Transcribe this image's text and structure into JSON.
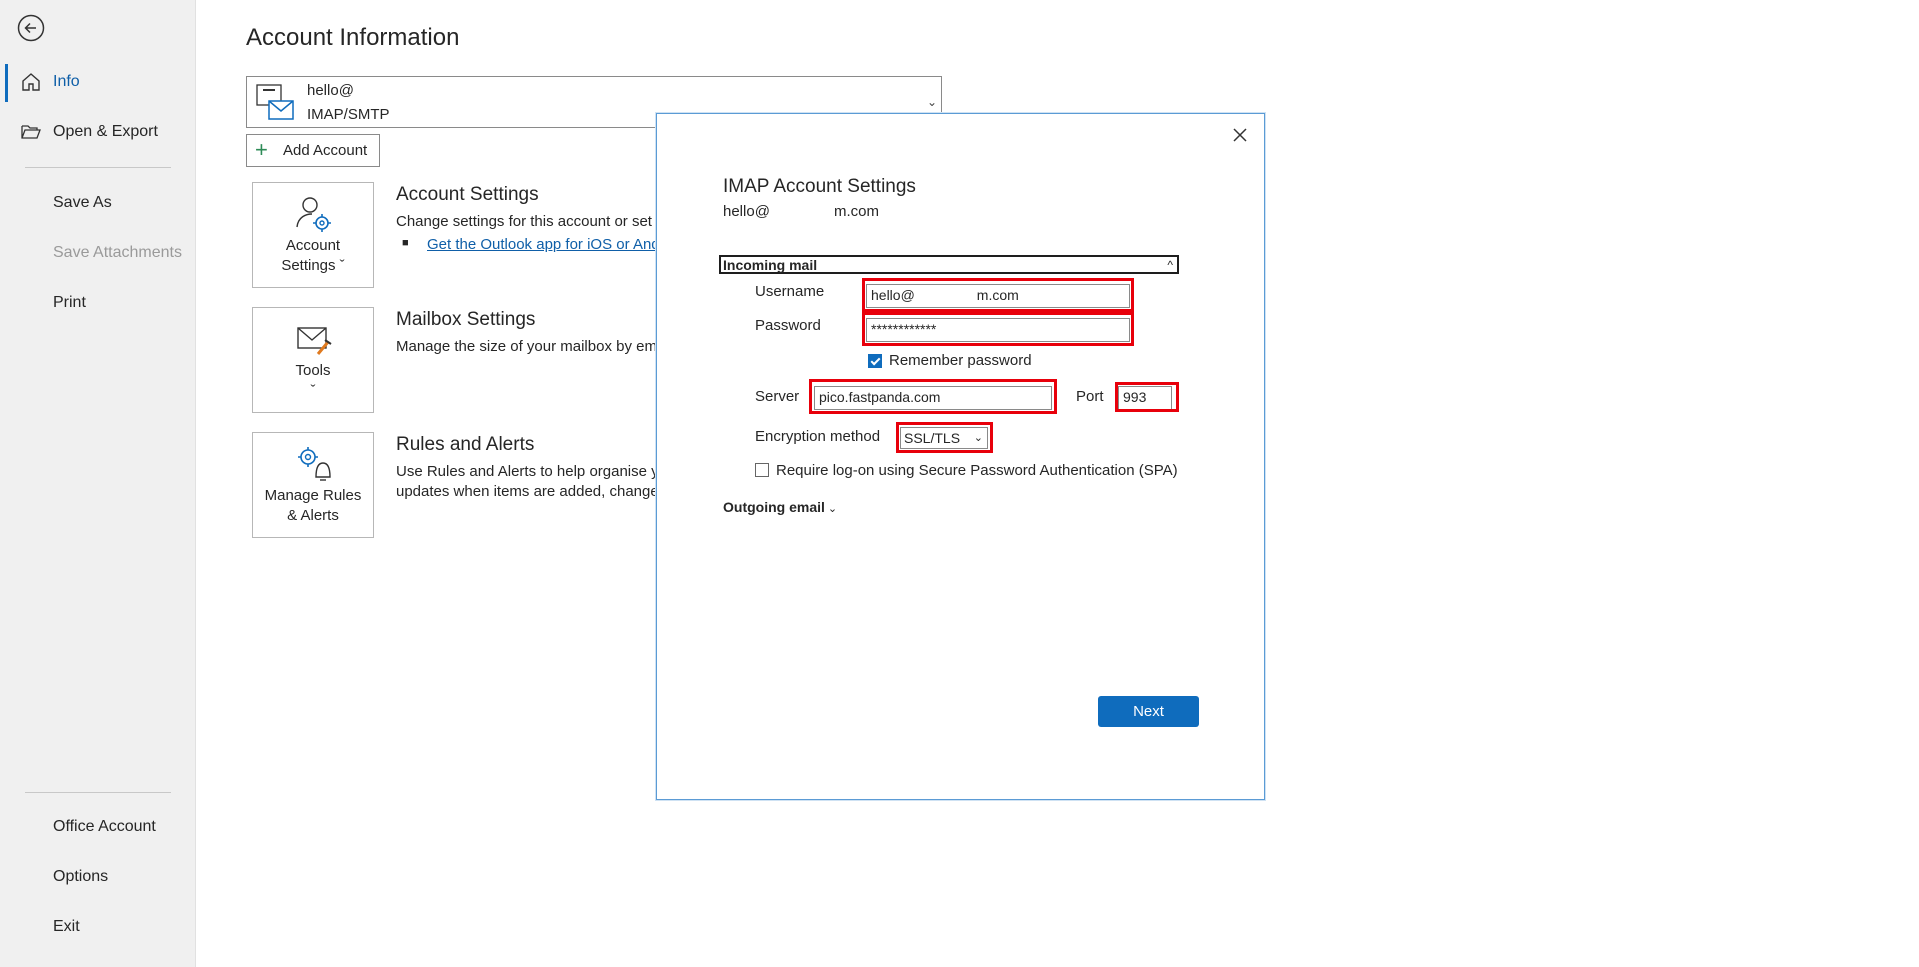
{
  "sidebar": {
    "back_icon": "back-arrow-icon",
    "items": [
      {
        "label": "Info",
        "icon": "home-icon",
        "active": true
      },
      {
        "label": "Open & Export",
        "icon": "folder-open-icon"
      },
      {
        "label": "Save As"
      },
      {
        "label": "Save Attachments",
        "disabled": true
      },
      {
        "label": "Print"
      },
      {
        "label": "Office Account"
      },
      {
        "label": "Options"
      },
      {
        "label": "Exit"
      }
    ]
  },
  "main": {
    "title": "Account Information",
    "account": {
      "email": "hello@",
      "type": "IMAP/SMTP"
    },
    "add_account_label": "Add Account",
    "tiles": [
      {
        "label_1": "Account",
        "label_2": "Settings ˇ",
        "icon": "account-settings-icon"
      },
      {
        "label_1": "Tools",
        "label_2": "ˇ",
        "icon": "tools-icon"
      },
      {
        "label_1": "Manage Rules",
        "label_2": "& Alerts",
        "icon": "rules-alerts-icon"
      }
    ],
    "sections": [
      {
        "title": "Account Settings",
        "text": "Change settings for this account or set u",
        "link": "Get the Outlook app for iOS or And"
      },
      {
        "title": "Mailbox Settings",
        "text": "Manage the size of your mailbox by em"
      },
      {
        "title": "Rules and Alerts",
        "text_1": "Use Rules and Alerts to help organise yo",
        "text_2": "updates when items are added, change"
      }
    ]
  },
  "dialog": {
    "title": "IMAP Account Settings",
    "email_prefix": "hello@",
    "email_suffix": "m.com",
    "incoming_header": "Incoming mail",
    "username_label": "Username",
    "username_value_prefix": "hello@",
    "username_value_suffix": "m.com",
    "password_label": "Password",
    "password_value": "************",
    "remember_password_label": "Remember password",
    "remember_password_checked": true,
    "server_label": "Server",
    "server_value": "pico.fastpanda.com",
    "port_label": "Port",
    "port_value": "993",
    "encryption_label": "Encryption method",
    "encryption_value": "SSL/TLS",
    "spa_label": "Require log-on using Secure Password Authentication (SPA)",
    "spa_checked": false,
    "outgoing_header": "Outgoing email",
    "next_label": "Next",
    "highlight_color": "#e8000b",
    "accent_color": "#0f6cbd"
  }
}
